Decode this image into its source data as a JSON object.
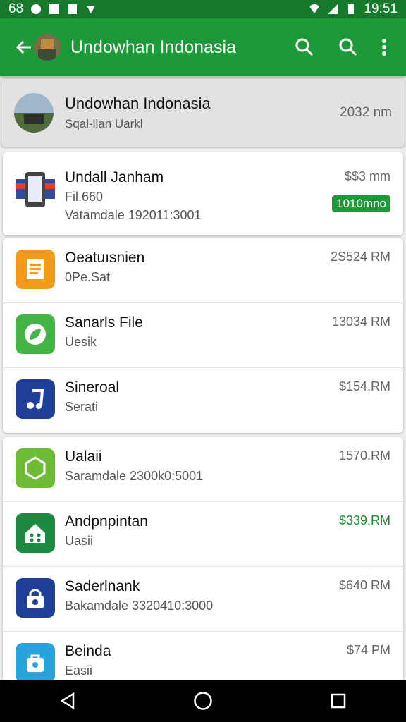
{
  "status_bar": {
    "left_icons_text": "68",
    "time": "19:51"
  },
  "app_bar": {
    "title": "Undowhan Indonasia"
  },
  "header": {
    "title": "Undowhan Indonasia",
    "subtitle": "Sqal-llan Uarkl",
    "time": "2032 nm"
  },
  "rows": [
    {
      "title": "Undall Janham",
      "line2": "Fil.660",
      "line3": "Vatamdale 192011:3001",
      "amount": "$$3 mm",
      "badge": "1010mno",
      "icon": "phone-list-icon",
      "icon_color": "#ffffff"
    },
    {
      "title": "Oeatuısnien",
      "sub": "0Pe.Sat",
      "amount": "2S524 RM",
      "icon": "document-icon",
      "icon_color": "#f39a1d"
    },
    {
      "title": "Sanarls File",
      "sub": "Uesik",
      "amount": "13034 RM",
      "icon": "leaf-icon",
      "icon_color": "#43b545"
    },
    {
      "title": "Sineroal",
      "sub": "Serati",
      "amount": "$154.RM",
      "icon": "music-note-icon",
      "icon_color": "#1f3f99"
    },
    {
      "title": "Ualaii",
      "sub": "Saramdale 2300k0:5001",
      "amount": "1570.RM",
      "icon": "hexagon-icon",
      "icon_color": "#6cbc35"
    },
    {
      "title": "Andpnpintan",
      "sub": "Uasii",
      "amount": "$339.RM",
      "amount_green": true,
      "icon": "home-icon",
      "icon_color": "#1e8a3f"
    },
    {
      "title": "Saderlnank",
      "sub": "Bakamdale 3320410:3000",
      "amount": "$640 RM",
      "icon": "lock-icon",
      "icon_color": "#1f3f99"
    },
    {
      "title": "Beinda",
      "sub": "Easii",
      "amount": "$74 PM",
      "icon": "bag-icon",
      "icon_color": "#29a3dc"
    }
  ]
}
